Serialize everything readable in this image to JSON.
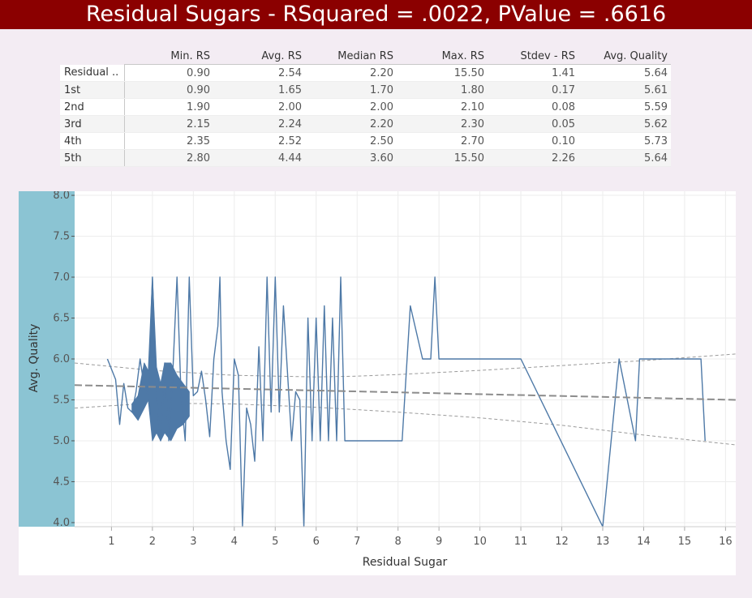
{
  "title": "Residual Sugars  - RSquared = .0022, PValue = .6616",
  "table": {
    "columns": [
      "Min. RS",
      "Avg. RS",
      "Median RS",
      "Max. RS",
      "Stdev - RS",
      "Avg. Quality"
    ],
    "rows": [
      {
        "label": "Residual ..",
        "values": [
          "0.90",
          "2.54",
          "2.20",
          "15.50",
          "1.41",
          "5.64"
        ]
      },
      {
        "label": "1st",
        "values": [
          "0.90",
          "1.65",
          "1.70",
          "1.80",
          "0.17",
          "5.61"
        ]
      },
      {
        "label": "2nd",
        "values": [
          "1.90",
          "2.00",
          "2.00",
          "2.10",
          "0.08",
          "5.59"
        ]
      },
      {
        "label": "3rd",
        "values": [
          "2.15",
          "2.24",
          "2.20",
          "2.30",
          "0.05",
          "5.62"
        ]
      },
      {
        "label": "4th",
        "values": [
          "2.35",
          "2.52",
          "2.50",
          "2.70",
          "0.10",
          "5.73"
        ]
      },
      {
        "label": "5th",
        "values": [
          "2.80",
          "4.44",
          "3.60",
          "15.50",
          "2.26",
          "5.64"
        ]
      }
    ]
  },
  "colors": {
    "title_bg": "#8b0000",
    "line": "#4e79a7",
    "trend": "#8c8c8c",
    "y_band": "#8bc4d3",
    "page_bg": "#f3ecf3"
  },
  "chart_data": {
    "type": "line",
    "xlabel": "Residual Sugar",
    "ylabel": "Avg. Quality",
    "xlim": [
      0.1,
      16.25
    ],
    "ylim": [
      3.95,
      8.05
    ],
    "x_ticks": [
      "1",
      "2",
      "3",
      "4",
      "5",
      "6",
      "7",
      "8",
      "9",
      "10",
      "11",
      "12",
      "13",
      "14",
      "15",
      "16"
    ],
    "y_ticks": [
      "8.0",
      "7.5",
      "7.0",
      "6.5",
      "6.0",
      "5.5",
      "5.0",
      "4.5",
      "4.0"
    ],
    "grid": true,
    "series": [
      {
        "x": [
          0.9,
          1.1,
          1.2,
          1.3,
          1.4,
          1.5,
          1.6,
          1.7,
          1.8,
          1.9,
          2.0,
          2.1,
          2.2,
          2.3,
          2.4,
          2.5,
          2.6,
          2.7,
          2.8,
          2.9,
          3.0,
          3.1,
          3.2,
          3.3,
          3.4,
          3.5,
          3.6,
          3.65,
          3.7,
          3.8,
          3.9,
          4.0,
          4.1,
          4.2,
          4.3,
          4.4,
          4.5,
          4.6,
          4.7,
          4.8,
          4.9,
          5.0,
          5.1,
          5.2,
          5.4,
          5.5,
          5.6,
          5.7,
          5.8,
          5.9,
          6.0,
          6.1,
          6.2,
          6.3,
          6.4,
          6.5,
          6.6,
          6.7,
          7.0,
          8.1,
          8.3,
          8.6,
          8.8,
          8.9,
          9.0,
          11.0,
          13.0,
          13.4,
          13.8,
          13.9,
          15.4,
          15.5
        ],
        "y": [
          6.0,
          5.75,
          5.2,
          5.7,
          5.4,
          5.35,
          5.6,
          6.0,
          5.65,
          5.55,
          7.0,
          5.55,
          5.0,
          5.95,
          5.0,
          5.85,
          7.0,
          5.55,
          5.0,
          7.0,
          5.55,
          5.6,
          5.85,
          5.5,
          5.05,
          6.0,
          6.4,
          7.0,
          5.6,
          5.0,
          4.65,
          6.0,
          5.8,
          3.95,
          5.4,
          5.2,
          4.75,
          6.15,
          5.0,
          7.0,
          5.35,
          7.0,
          5.35,
          6.65,
          5.0,
          5.6,
          5.5,
          3.95,
          6.5,
          5.0,
          6.5,
          5.0,
          6.65,
          5.0,
          6.5,
          5.0,
          7.0,
          5.0,
          5.0,
          5.0,
          6.65,
          6.0,
          6.0,
          7.0,
          6.0,
          6.0,
          3.95,
          6.0,
          5.0,
          6.0,
          6.0,
          5.0
        ]
      }
    ],
    "band": {
      "x": [
        1.5,
        1.65,
        1.8,
        1.9,
        2.0,
        2.1,
        2.2,
        2.3,
        2.45,
        2.6,
        2.75,
        2.9
      ],
      "y_upper": [
        5.45,
        5.55,
        5.95,
        5.85,
        7.0,
        5.9,
        5.7,
        5.95,
        5.95,
        5.8,
        5.7,
        5.6
      ],
      "y_lower": [
        5.35,
        5.25,
        5.4,
        5.5,
        5.0,
        5.1,
        5.0,
        5.1,
        5.0,
        5.15,
        5.2,
        5.3
      ]
    },
    "trend": {
      "x": [
        0.1,
        16.25
      ],
      "y": [
        5.68,
        5.5
      ]
    },
    "confidence": {
      "x": [
        0.1,
        2,
        4,
        6,
        7,
        8,
        10,
        12,
        14,
        16.25
      ],
      "upper": [
        5.95,
        5.86,
        5.8,
        5.78,
        5.79,
        5.81,
        5.86,
        5.92,
        5.98,
        6.06
      ],
      "lower": [
        5.4,
        5.46,
        5.45,
        5.41,
        5.38,
        5.35,
        5.28,
        5.19,
        5.07,
        4.95
      ]
    }
  }
}
